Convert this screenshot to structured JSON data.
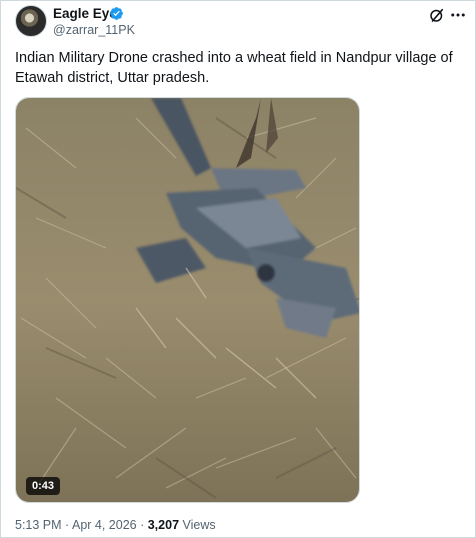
{
  "author": {
    "name": "Eagle Eye",
    "handle": "@zarrar_11PK",
    "verified": true,
    "avatar_icon": "eagle-avatar"
  },
  "tweet": {
    "text": "Indian Military Drone crashed into a wheat field in Nandpur village of Etawah district, Uttar pradesh."
  },
  "media": {
    "type": "video",
    "duration": "0:43"
  },
  "meta": {
    "time": "5:13 PM",
    "separator": " · ",
    "date": "Apr 4, 2026",
    "separator2": " · ",
    "views_count": "3,207",
    "views_label": " Views"
  },
  "icons": {
    "grok": "grok-icon",
    "more": "more-options-icon",
    "verified": "verified-badge-icon"
  },
  "colors": {
    "verified_blue": "#1d9bf0",
    "secondary_text": "#536471",
    "border": "#cfd9de"
  }
}
